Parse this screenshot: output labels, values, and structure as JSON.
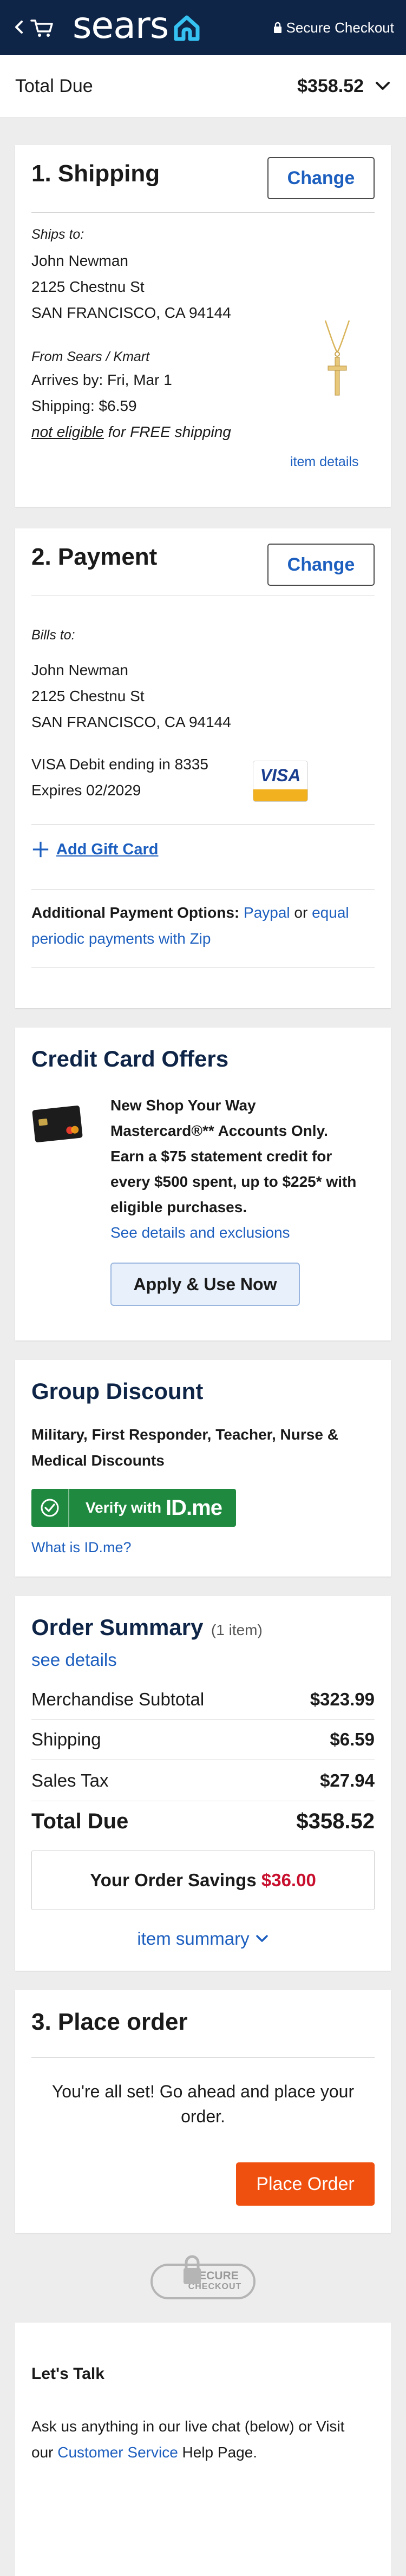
{
  "header": {
    "brand": "sears",
    "secure_label": "Secure Checkout"
  },
  "total_bar": {
    "label": "Total Due",
    "amount": "$358.52"
  },
  "shipping": {
    "title": "1. Shipping",
    "change_label": "Change",
    "ships_to_label": "Ships to:",
    "name": "John Newman",
    "street": "2125 Chestnu St",
    "city": "SAN FRANCISCO, CA 94144",
    "from": "From Sears / Kmart",
    "arrives": "Arrives by: Fri, Mar 1",
    "shipping_cost": "Shipping:  $6.59",
    "not_eligible": "not eligible",
    "free_shipping": " for FREE shipping",
    "item_details": "item details"
  },
  "payment": {
    "title": "2. Payment",
    "change_label": "Change",
    "bills_to_label": "Bills to:",
    "name": "John Newman",
    "street": "2125 Chestnu St",
    "city": "SAN FRANCISCO, CA 94144",
    "card": "VISA Debit ending in 8335",
    "expires": "Expires 02/2029",
    "card_brand": "VISA",
    "add_gift_card": "Add Gift Card",
    "additional_label": "Additional Payment Options: ",
    "paypal": "Paypal",
    "or": " or ",
    "zip_line1": "equal",
    "zip_line2": "periodic payments with Zip"
  },
  "credit_offer": {
    "title": "Credit Card Offers",
    "line1": "New Shop Your Way",
    "line2": "Mastercard®** Accounts Only.",
    "line3": "Earn a $75 statement credit for",
    "line4": "every $500 spent, up to $225* with",
    "line5": "eligible purchases.",
    "details_link": "See details and exclusions",
    "apply_label": "Apply & Use Now"
  },
  "group_discount": {
    "title": "Group Discount",
    "desc1": "Military, First Responder, Teacher, Nurse &",
    "desc2": "Medical Discounts",
    "verify_label": "Verify with",
    "verify_brand": "ID.me",
    "what_is": "What is ID.me?"
  },
  "order_summary": {
    "title": "Order Summary",
    "count": "(1 item)",
    "see_details": "see details",
    "rows": [
      {
        "label": "Merchandise Subtotal",
        "value": "$323.99"
      },
      {
        "label": "Shipping",
        "value": "$6.59"
      },
      {
        "label": "Sales Tax",
        "value": "$27.94"
      }
    ],
    "total_label": "Total Due",
    "total_value": "$358.52",
    "savings_label": "Your Order Savings ",
    "savings_value": "$36.00",
    "item_summary": "item summary"
  },
  "place_order": {
    "title": "3. Place order",
    "message1": "You're all set! Go ahead and place your",
    "message2": "order.",
    "button_label": "Place Order"
  },
  "secure_badge": {
    "line1": "SECURE",
    "line2": "CHECKOUT"
  },
  "lets_talk": {
    "title": "Let's Talk",
    "line1": "Ask us anything in our live chat (below) or Visit",
    "line2_prefix": "our ",
    "link": "Customer Service",
    "line2_suffix": " Help Page."
  },
  "colors": {
    "header_bg": "#0f2547",
    "link": "#1d5fbf",
    "place_order": "#f0500f",
    "savings": "#c8102e",
    "idme_green": "#1f8a3f"
  },
  "icons": [
    "back-chevron-icon",
    "cart-icon",
    "sears-house-icon",
    "lock-icon",
    "chevron-down-icon",
    "plus-icon",
    "check-shield-icon"
  ]
}
